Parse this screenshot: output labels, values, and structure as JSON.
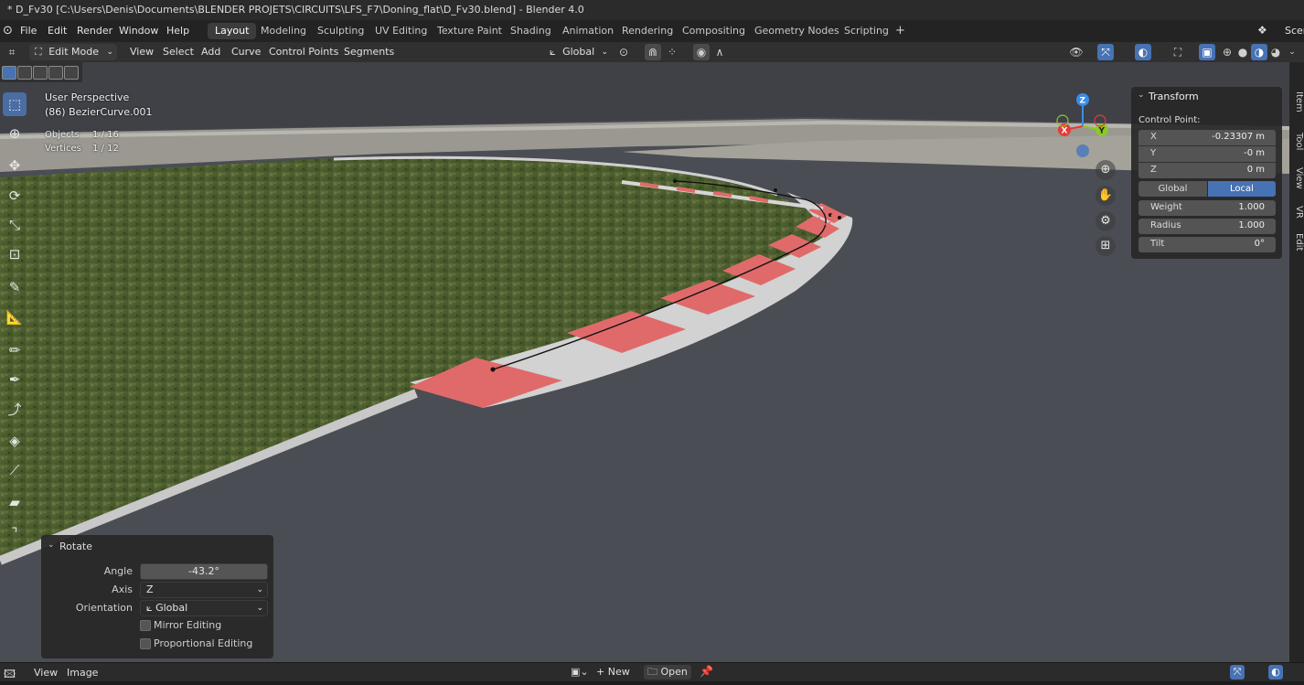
{
  "window_title": "* D_Fv30 [C:\\Users\\Denis\\Documents\\BLENDER PROJETS\\CIRCUITS\\LFS_F7\\Doning_flat\\D_Fv30.blend] - Blender 4.0",
  "menu": [
    "File",
    "Edit",
    "Render",
    "Window",
    "Help"
  ],
  "workspaces": [
    "Layout",
    "Modeling",
    "Sculpting",
    "UV Editing",
    "Texture Paint",
    "Shading",
    "Animation",
    "Rendering",
    "Compositing",
    "Geometry Nodes",
    "Scripting"
  ],
  "scene_label": "Scen",
  "header": {
    "mode": "Edit Mode",
    "menus": [
      "View",
      "Select",
      "Add",
      "Curve",
      "Control Points",
      "Segments"
    ],
    "orientation": "Global"
  },
  "viewport_info": {
    "perspective": "User Perspective",
    "object": "(86) BezierCurve.001",
    "objects_label": "Objects",
    "objects_value": "1 / 16",
    "vertices_label": "Vertices",
    "vertices_value": "1 / 12"
  },
  "gizmo": {
    "z": "Z",
    "x": "X",
    "y": "Y"
  },
  "sidebar_tabs": [
    "Item",
    "Tool",
    "View",
    "VR",
    "Edit"
  ],
  "transform_panel": {
    "title": "Transform",
    "subtitle": "Control Point:",
    "x_label": "X",
    "x_value": "-0.23307 m",
    "y_label": "Y",
    "y_value": "-0 m",
    "z_label": "Z",
    "z_value": "0 m",
    "global_label": "Global",
    "local_label": "Local",
    "weight_label": "Weight",
    "weight_value": "1.000",
    "radius_label": "Radius",
    "radius_value": "1.000",
    "tilt_label": "Tilt",
    "tilt_value": "0°"
  },
  "operator_panel": {
    "title": "Rotate",
    "angle_label": "Angle",
    "angle_value": "-43.2°",
    "axis_label": "Axis",
    "axis_value": "Z",
    "orientation_label": "Orientation",
    "orientation_value": "Global",
    "mirror_label": "Mirror Editing",
    "proportional_label": "Proportional Editing"
  },
  "bottom_bar": {
    "view": "View",
    "image": "Image",
    "new": "New",
    "open": "Open"
  },
  "colors": {
    "accent": "#4772b3",
    "x_axis": "#e53a3a",
    "y_axis": "#8ac926",
    "z_axis": "#3a8ee6",
    "kerb_red": "#e06a6a"
  }
}
